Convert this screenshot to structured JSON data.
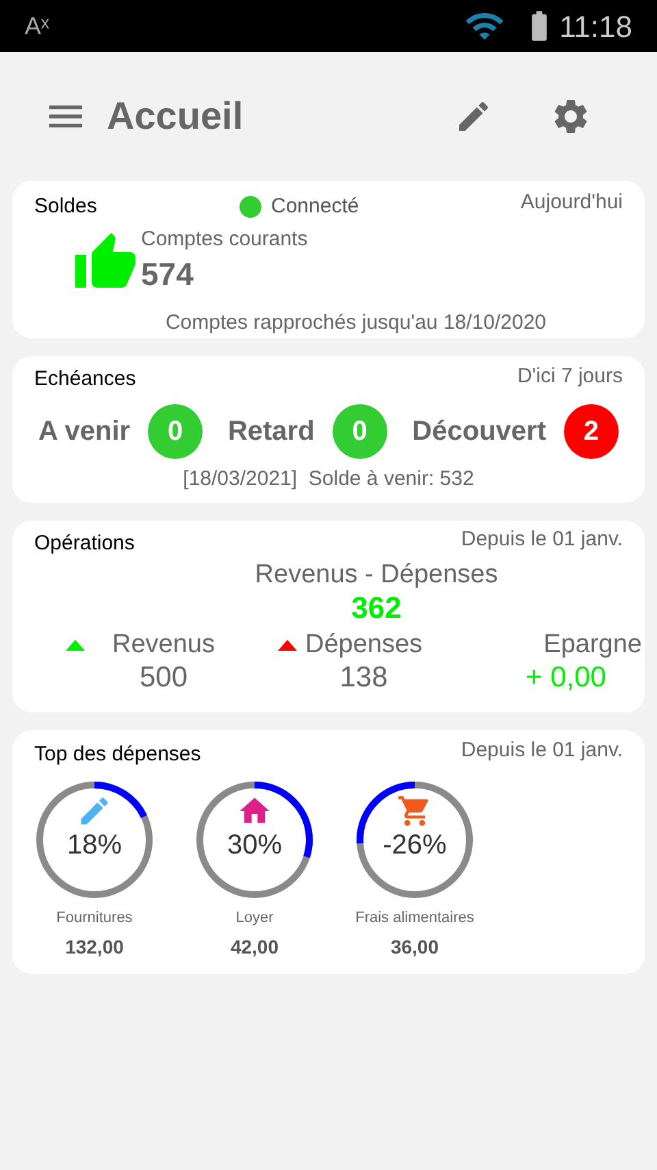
{
  "status_bar": {
    "left_icon_text": "Aˣ",
    "time": "11:18"
  },
  "header": {
    "title": "Accueil"
  },
  "soldes": {
    "title": "Soldes",
    "status": {
      "label": "Connecté",
      "color": "#33cc33"
    },
    "period": "Aujourd'hui",
    "account_label": "Comptes courants",
    "amount": "574",
    "footer": "Comptes rapprochés jusqu'au 18/10/2020"
  },
  "echeances": {
    "title": "Echéances",
    "period": "D'ici 7 jours",
    "items": [
      {
        "label": "A venir",
        "count": "0",
        "color": "#33cc33"
      },
      {
        "label": "Retard",
        "count": "0",
        "color": "#33cc33"
      },
      {
        "label": "Découvert",
        "count": "2",
        "color": "#ff0000"
      }
    ],
    "footer": "[18/03/2021]  Solde à venir: 532"
  },
  "operations": {
    "title": "Opérations",
    "period": "Depuis le 01 janv.",
    "net_label": "Revenus - Dépenses",
    "net_value": "362",
    "items": [
      {
        "label": "Revenus",
        "value": "500",
        "color": "#00ee00"
      },
      {
        "label": "Dépenses",
        "value": "138",
        "color": "#ff0000"
      }
    ],
    "savings_label": "Epargne",
    "savings_value": "+ 0,00"
  },
  "top": {
    "title": "Top des dépenses",
    "period": "Depuis le 01 janv.",
    "items": [
      {
        "kind": "pencil",
        "percent": "18%",
        "label": "Fournitures",
        "amount": "132,00"
      },
      {
        "kind": "house",
        "percent": "30%",
        "label": "Loyer",
        "amount": "42,00"
      },
      {
        "kind": "cart",
        "percent": "-26%",
        "label": "Frais alimentaires",
        "amount": "36,00"
      }
    ]
  }
}
